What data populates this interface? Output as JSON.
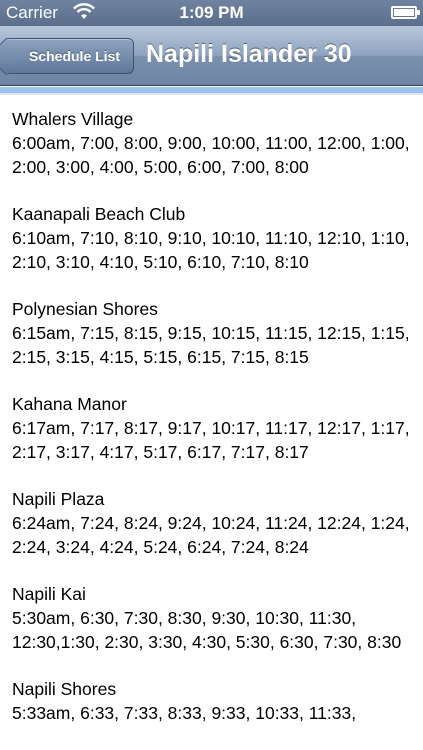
{
  "status_bar": {
    "carrier": "Carrier",
    "time": "1:09 PM"
  },
  "nav": {
    "back_label": "Schedule List",
    "title": "Napili Islander 30"
  },
  "stops": [
    {
      "name": "Whalers Village",
      "times": "6:00am, 7:00, 8:00, 9:00, 10:00, 11:00, 12:00, 1:00, 2:00, 3:00, 4:00, 5:00, 6:00, 7:00, 8:00"
    },
    {
      "name": "Kaanapali Beach Club",
      "times": "6:10am, 7:10, 8:10, 9:10, 10:10, 11:10, 12:10, 1:10, 2:10, 3:10, 4:10, 5:10, 6:10, 7:10, 8:10"
    },
    {
      "name": "Polynesian Shores",
      "times": "6:15am, 7:15, 8:15, 9:15, 10:15, 11:15, 12:15, 1:15, 2:15, 3:15, 4:15, 5:15, 6:15, 7:15, 8:15"
    },
    {
      "name": "Kahana Manor",
      "times": "6:17am, 7:17, 8:17, 9:17, 10:17, 11:17, 12:17, 1:17, 2:17, 3:17, 4:17, 5:17, 6:17, 7:17, 8:17"
    },
    {
      "name": "Napili Plaza",
      "times": "6:24am, 7:24, 8:24, 9:24, 10:24, 11:24, 12:24, 1:24, 2:24, 3:24, 4:24, 5:24, 6:24, 7:24, 8:24"
    },
    {
      "name": "Napili Kai",
      "times": "5:30am, 6:30, 7:30, 8:30, 9:30, 10:30, 11:30, 12:30,1:30, 2:30, 3:30, 4:30, 5:30, 6:30, 7:30, 8:30"
    },
    {
      "name": "Napili Shores",
      "times": "5:33am, 6:33, 7:33, 8:33, 9:33, 10:33, 11:33,"
    }
  ]
}
